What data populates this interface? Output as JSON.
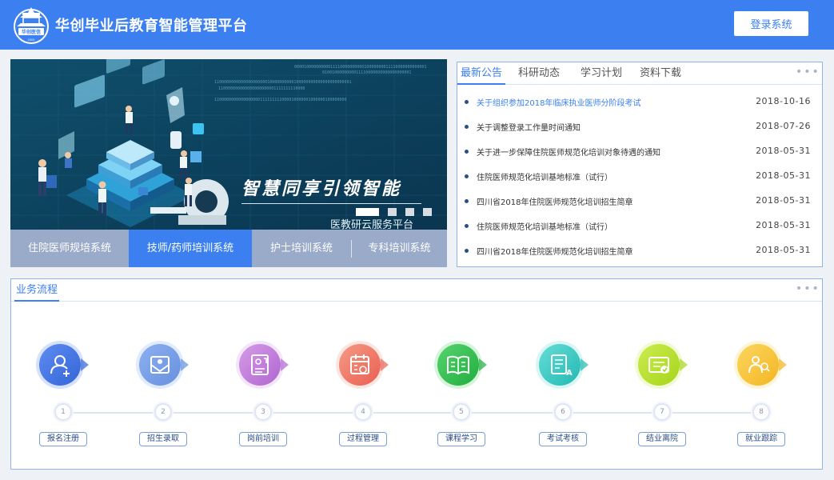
{
  "header": {
    "title": "华创毕业后教育智能管理平台",
    "logo_text": "华创医信",
    "login_label": "登录系统",
    "color": "#3b7ff0"
  },
  "banner": {
    "slogan": "智慧同享引领智能",
    "sub_slogan": "医教研云服务平台",
    "active_slide": 1,
    "slide_count": 4,
    "binary_lines": [
      "0000100000000001111000000000010000000011110000000000001",
      "0100100000000011110000000000000000001",
      "110000000000000000000010000000000100000000000000000000001",
      "110000000000000000000001111111110000",
      "1100000000000000000111111111000010000001000000100000000"
    ]
  },
  "system_tabs": [
    {
      "label": "住院医师规培系统",
      "active": false
    },
    {
      "label": "技师/药师培训系统",
      "active": true
    },
    {
      "label": "护士培训系统",
      "active": false
    },
    {
      "label": "专科培训系统",
      "active": false
    }
  ],
  "news": {
    "tabs": [
      {
        "label": "最新公告",
        "active": true
      },
      {
        "label": "科研动态",
        "active": false
      },
      {
        "label": "学习计划",
        "active": false
      },
      {
        "label": "资料下载",
        "active": false
      }
    ],
    "more_label": "•••",
    "items": [
      {
        "title": "关于组织参加2018年临床执业医师分阶段考试",
        "date": "2018-10-16"
      },
      {
        "title": "关于调整登录工作量时间通知",
        "date": "2018-07-26"
      },
      {
        "title": "关于进一步保障住院医师规范化培训对象待遇的通知",
        "date": "2018-05-31"
      },
      {
        "title": "住院医师规范化培训基地标准（试行）",
        "date": "2018-05-31"
      },
      {
        "title": "四川省2018年住院医师规范化培训招生简章",
        "date": "2018-05-31"
      },
      {
        "title": "住院医师规范化培训基地标准（试行）",
        "date": "2018-05-31"
      },
      {
        "title": "四川省2018年住院医师规范化培训招生简章",
        "date": "2018-05-31"
      }
    ]
  },
  "process": {
    "title": "业务流程",
    "more_label": "•••",
    "steps": [
      {
        "num": "1",
        "label": "报名注册",
        "icon": "user-add-icon",
        "color1": "#5d8cf2",
        "color2": "#3565d8"
      },
      {
        "num": "2",
        "label": "招生录取",
        "icon": "admission-letter-icon",
        "color1": "#8db0f0",
        "color2": "#6790de"
      },
      {
        "num": "3",
        "label": "岗前培训",
        "icon": "training-icon",
        "color1": "#d59be6",
        "color2": "#b066d1"
      },
      {
        "num": "4",
        "label": "过程管理",
        "icon": "calendar-icon",
        "color1": "#f59a86",
        "color2": "#ea5f52"
      },
      {
        "num": "5",
        "label": "课程学习",
        "icon": "book-icon",
        "color1": "#58d36f",
        "color2": "#1fae3d"
      },
      {
        "num": "6",
        "label": "考试考核",
        "icon": "exam-icon",
        "color1": "#66ddd6",
        "color2": "#22b9b3"
      },
      {
        "num": "7",
        "label": "结业离院",
        "icon": "certificate-icon",
        "color1": "#cbec4f",
        "color2": "#a6d51b"
      },
      {
        "num": "8",
        "label": "就业跟踪",
        "icon": "employment-icon",
        "color1": "#fbd760",
        "color2": "#f4b522"
      }
    ]
  }
}
